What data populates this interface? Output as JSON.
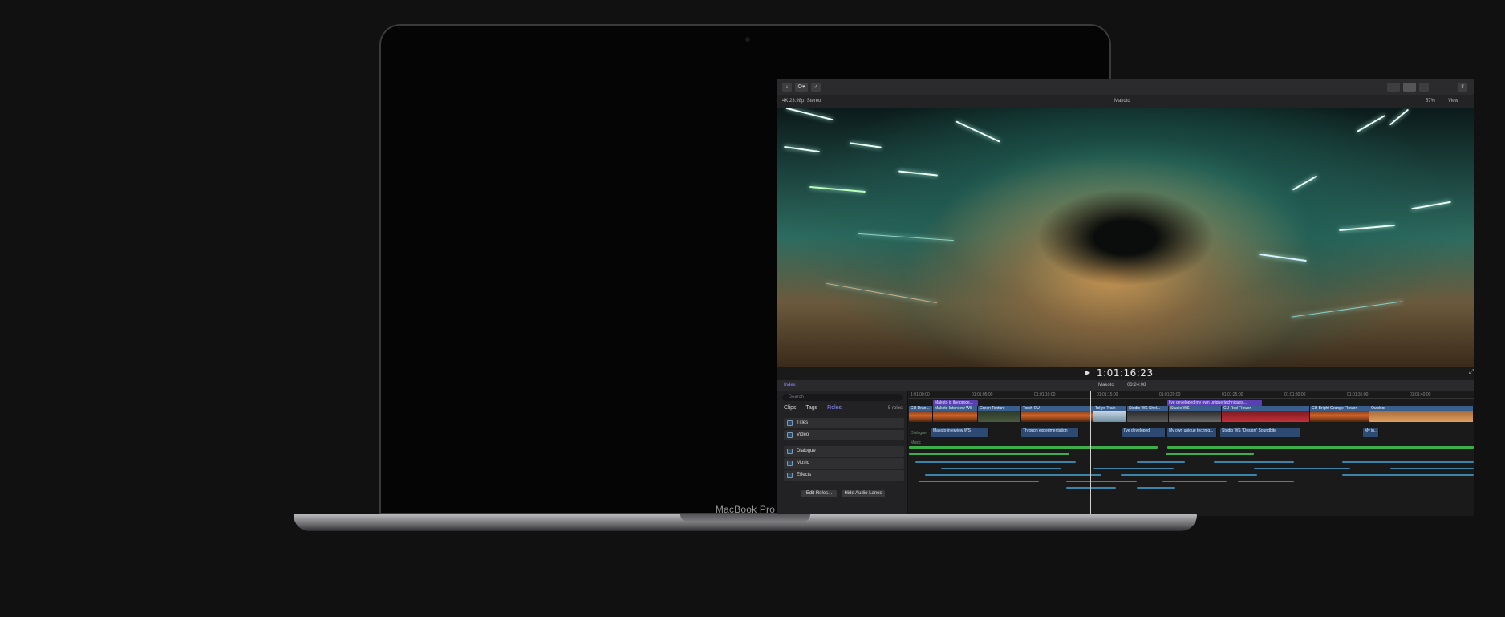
{
  "device": {
    "label": "MacBook Pro"
  },
  "toolbar": {
    "import_label": "↓",
    "keywords_label": "O▾",
    "check_label": "✓",
    "share_label": "⇪"
  },
  "viewer": {
    "format": "4K 23.98p, Stereo",
    "project_name": "Makoto",
    "zoom": "57%",
    "view_label": "View",
    "timecode": "1:01:16:23"
  },
  "timeline_bar": {
    "index_label": "Index",
    "project_name": "Makoto",
    "duration": "03:24:08"
  },
  "index": {
    "search_placeholder": "Search",
    "tabs": [
      "Clips",
      "Tags",
      "Roles"
    ],
    "role_count": "5 roles",
    "roles": [
      "Titles",
      "Video",
      "Dialogue",
      "Music",
      "Effects"
    ],
    "edit_roles": "Edit Roles...",
    "hide_audio_lanes": "Hide Audio Lanes"
  },
  "ruler": [
    "1:01:00:00",
    "01:01:05:00",
    "01:01:10:00",
    "01:01:15:00",
    "01:01:20:00",
    "01:01:25:00",
    "01:01:30:00",
    "01:01:35:00",
    "01:01:40:00"
  ],
  "titles": [
    "Makoto is the proce...",
    "I've developed my own unique techniques..."
  ],
  "video_clips": [
    "CU Dran...",
    "Makoto Interview WS",
    "Green Texture",
    "Torch CU",
    "Tokyo Train",
    "Studio WS Shel...",
    "Studio WS",
    "CU Red Flower",
    "CU Bright Orange Flower",
    "Outdoor"
  ],
  "audio_clips": [
    "Makoto interview WS",
    "Through experimentation",
    "I've developed",
    "My own unique techniq...",
    "Studio WS \"Design\" Soundbite",
    "My in..."
  ],
  "lane_labels": {
    "dialogue": "Dialogue",
    "music": "Music"
  }
}
